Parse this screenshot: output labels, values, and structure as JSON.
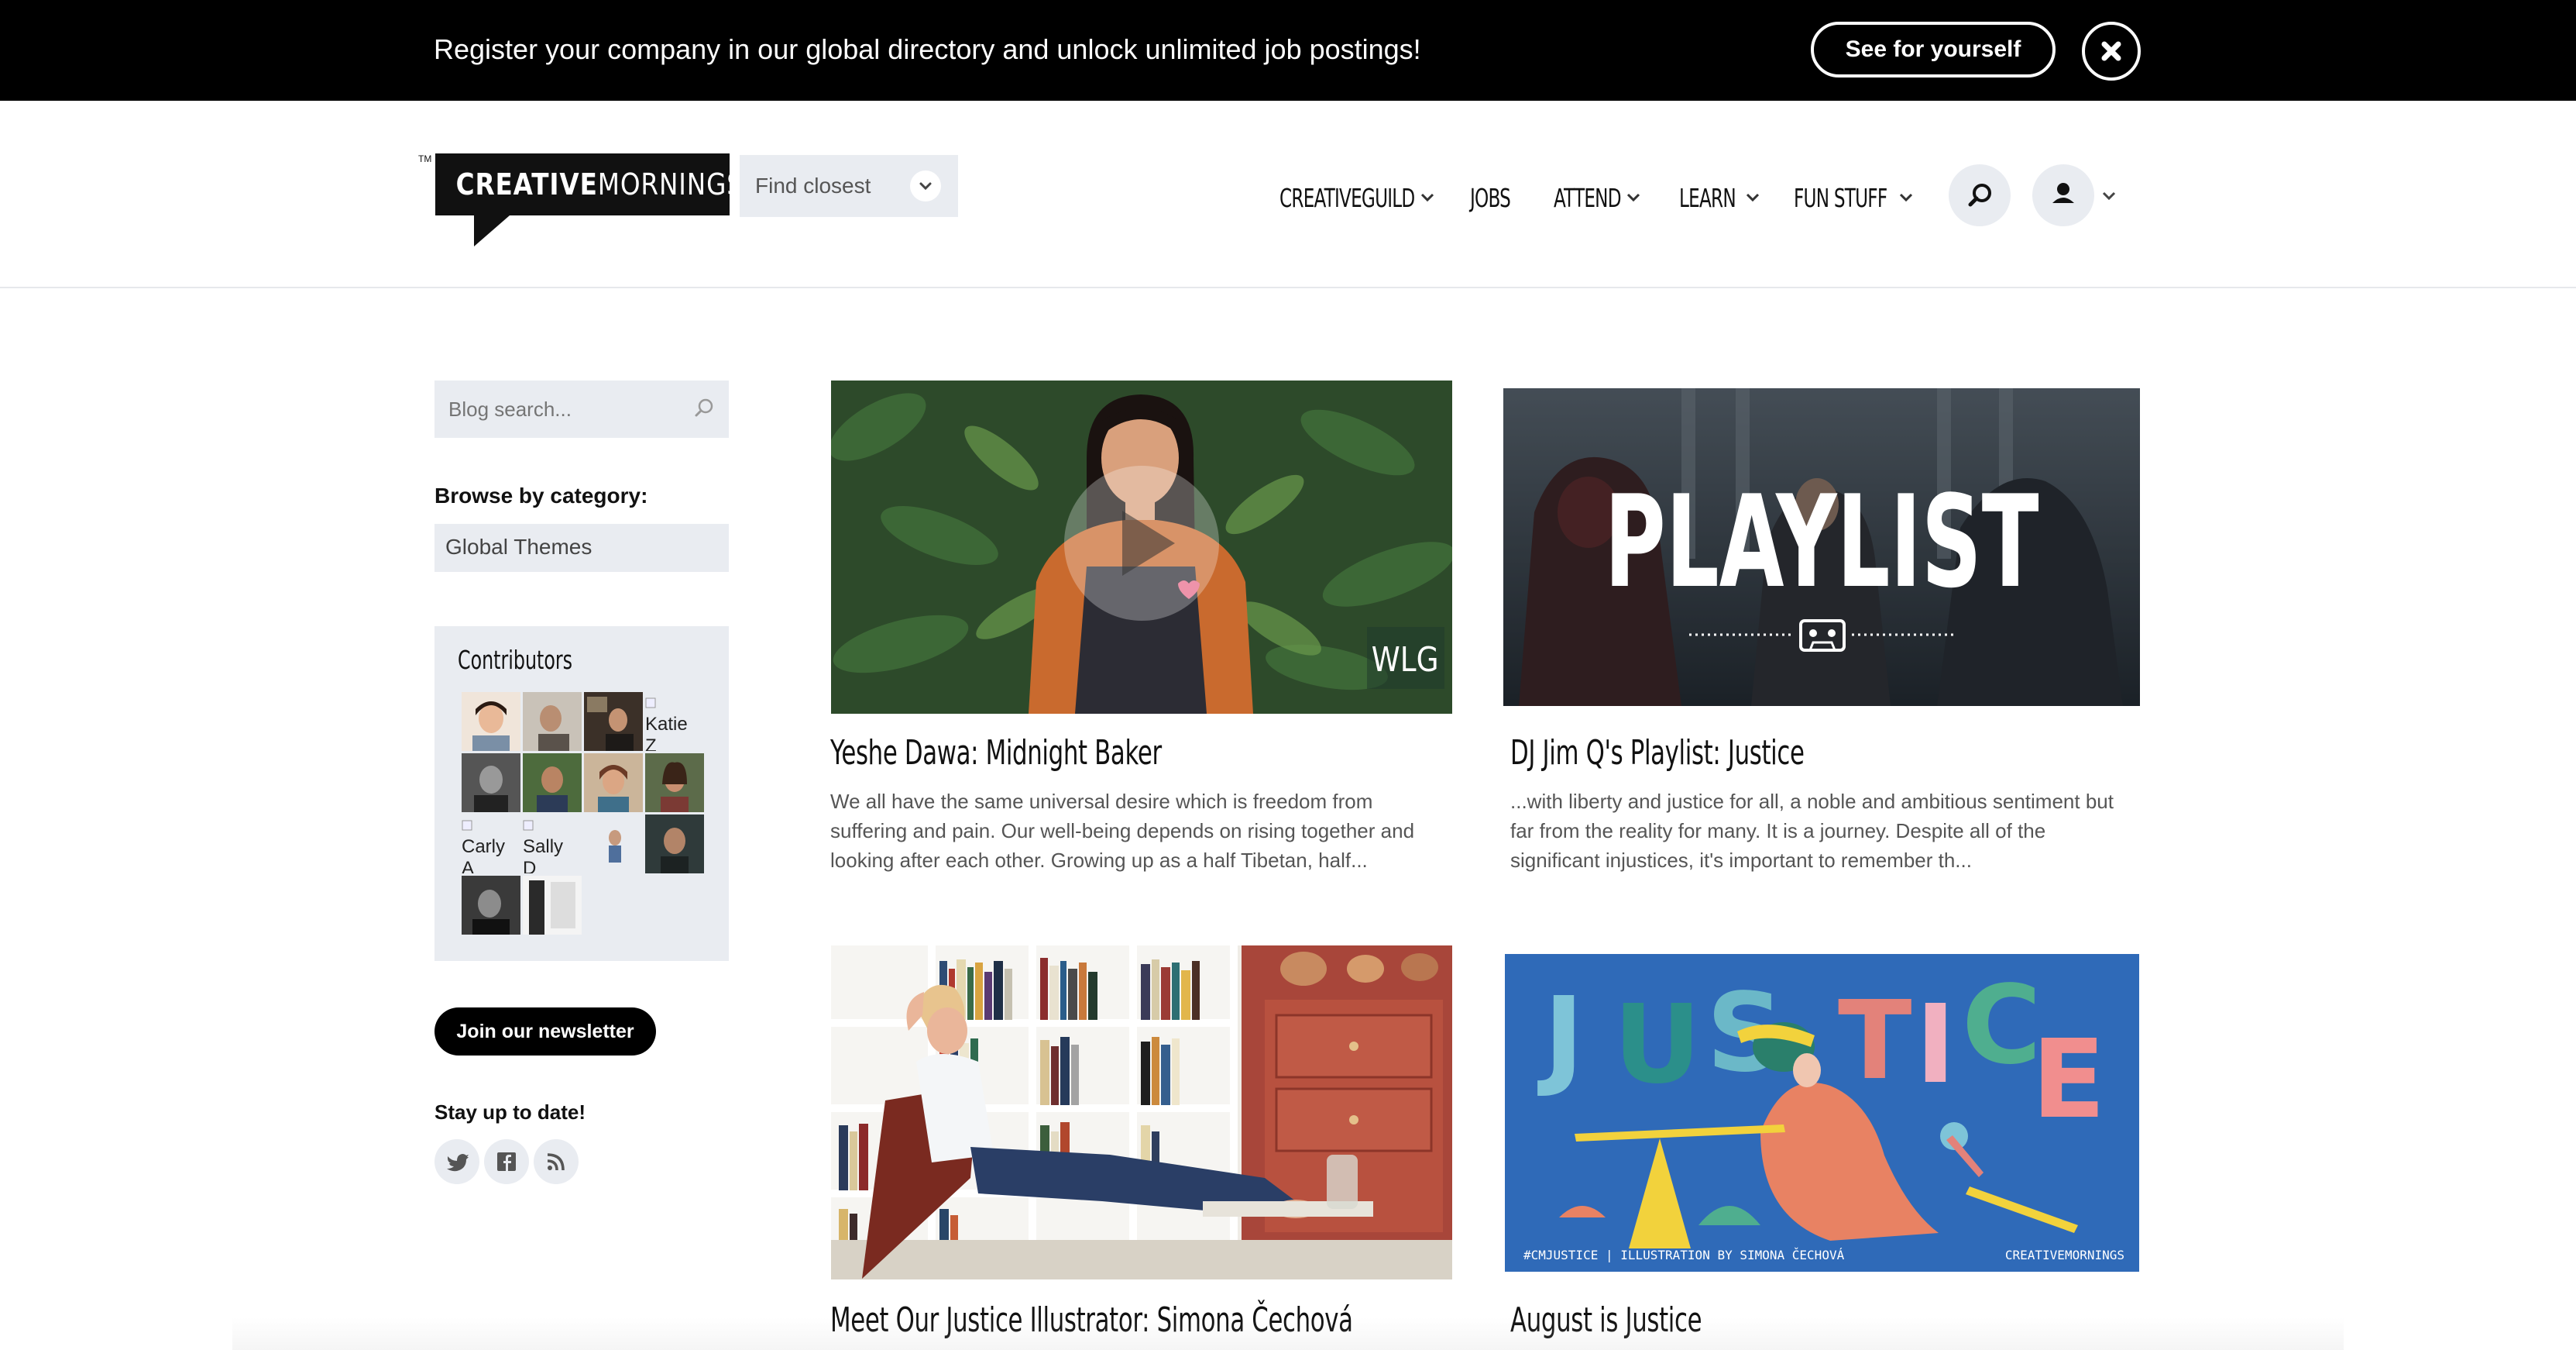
{
  "banner": {
    "text": "Register your company in our global directory and unlock unlimited job postings!",
    "cta_label": "See for yourself",
    "close_icon": "close-icon"
  },
  "header": {
    "logo_text_left": "CREATIVE",
    "logo_text_right": "MORNINGS",
    "logo_tm": "TM",
    "find_closest_label": "Find closest",
    "nav": [
      {
        "label": "CREATIVEGUILD",
        "has_dropdown": true
      },
      {
        "label": "JOBS",
        "has_dropdown": false
      },
      {
        "label": "ATTEND",
        "has_dropdown": true
      },
      {
        "label": "LEARN",
        "has_dropdown": true
      },
      {
        "label": "FUN STUFF",
        "has_dropdown": true
      }
    ],
    "search_icon": "search-icon",
    "account_icon": "user-icon"
  },
  "sidebar": {
    "search_placeholder": "Blog search...",
    "browse_label": "Browse by category:",
    "category_selected": "Global Themes",
    "contributors_title": "Contributors",
    "broken_avatar_labels": [
      "Katie Z",
      "Carly A",
      "Sally D"
    ],
    "newsletter_label": "Join our newsletter",
    "stay_label": "Stay up to date!",
    "social_icons": [
      "twitter-icon",
      "facebook-icon",
      "rss-icon"
    ]
  },
  "posts": [
    {
      "title": "Yeshe Dawa: Midnight Baker",
      "excerpt": "We all have the same universal desire which is freedom from suffering and pain. Our well-being depends on rising together and looking after each other. Growing up as a half Tibetan, half...",
      "image_badge": "WLG",
      "has_play_button": true
    },
    {
      "title": "DJ Jim Q's Playlist: Justice",
      "excerpt": "...with liberty and justice for all, a noble and ambitious sentiment but far from the reality for many. It is a journey. Despite all of the significant injustices, it's important to remember th...",
      "image_overlay": "PLAYLIST"
    },
    {
      "title": "Meet Our Justice Illustrator: Simona Čechová",
      "excerpt": ""
    },
    {
      "title": "August is Justice",
      "excerpt": "",
      "image_word": "JUSTICE",
      "image_caption_left": "#CMJUSTICE | ILLUSTRATION BY SIMONA ČECHOVÁ",
      "image_caption_right": "CREATIVEMORNINGS"
    }
  ],
  "colors": {
    "banner_bg": "#000000",
    "panel_bg": "#e9ecf1",
    "justice_blue": "#2f6ab8"
  }
}
